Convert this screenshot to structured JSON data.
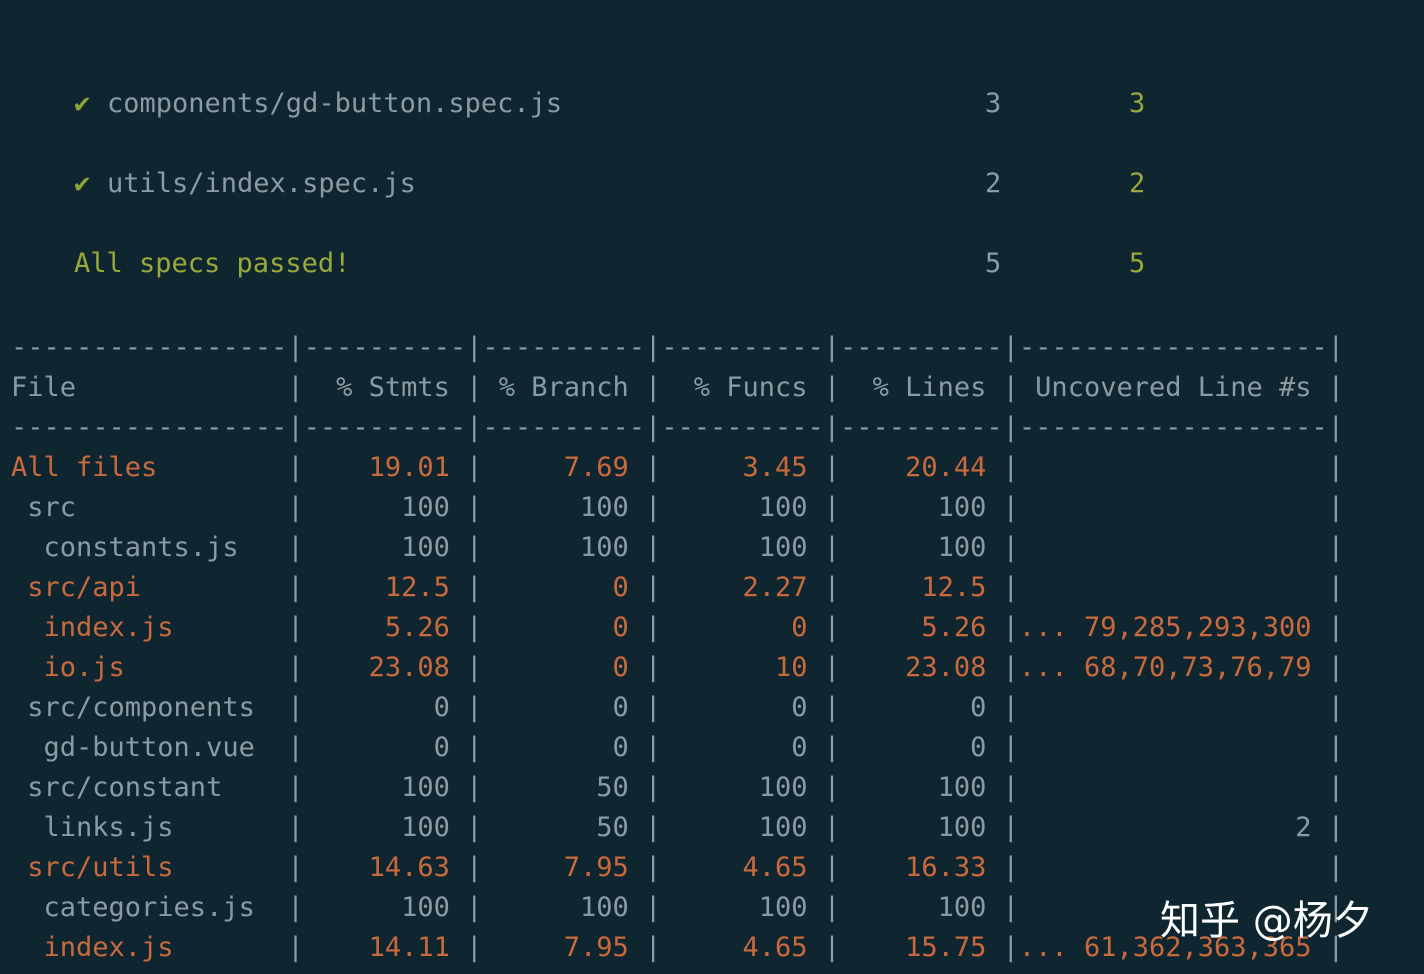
{
  "specs": [
    {
      "mark": "✔",
      "name": "components/gd-button.spec.js",
      "total": "3",
      "passed": "3"
    },
    {
      "mark": "✔",
      "name": "utils/index.spec.js",
      "total": "2",
      "passed": "2"
    }
  ],
  "summary": {
    "label": "All specs passed!",
    "total": "5",
    "passed": "5"
  },
  "coverage": {
    "separator": "-----------------|----------|----------|----------|----------|-------------------|",
    "headers": [
      "File",
      "% Stmts",
      "% Branch",
      "% Funcs",
      "% Lines",
      "Uncovered Line #s"
    ],
    "rows": [
      {
        "file": "All files",
        "indent": 0,
        "stmts": "19.01",
        "branch": "7.69",
        "funcs": "3.45",
        "lines": "20.44",
        "uncovered": "",
        "highlight": true
      },
      {
        "file": "src",
        "indent": 1,
        "stmts": "100",
        "branch": "100",
        "funcs": "100",
        "lines": "100",
        "uncovered": "",
        "highlight": false
      },
      {
        "file": "constants.js",
        "indent": 2,
        "stmts": "100",
        "branch": "100",
        "funcs": "100",
        "lines": "100",
        "uncovered": "",
        "highlight": false
      },
      {
        "file": "src/api",
        "indent": 1,
        "stmts": "12.5",
        "branch": "0",
        "funcs": "2.27",
        "lines": "12.5",
        "uncovered": "",
        "highlight": true
      },
      {
        "file": "index.js",
        "indent": 2,
        "stmts": "5.26",
        "branch": "0",
        "funcs": "0",
        "lines": "5.26",
        "uncovered": "... 79,285,293,300",
        "highlight": true
      },
      {
        "file": "io.js",
        "indent": 2,
        "stmts": "23.08",
        "branch": "0",
        "funcs": "10",
        "lines": "23.08",
        "uncovered": "... 68,70,73,76,79",
        "highlight": true
      },
      {
        "file": "src/components",
        "indent": 1,
        "stmts": "0",
        "branch": "0",
        "funcs": "0",
        "lines": "0",
        "uncovered": "",
        "highlight": false
      },
      {
        "file": "gd-button.vue",
        "indent": 2,
        "stmts": "0",
        "branch": "0",
        "funcs": "0",
        "lines": "0",
        "uncovered": "",
        "highlight": false
      },
      {
        "file": "src/constant",
        "indent": 1,
        "stmts": "100",
        "branch": "50",
        "funcs": "100",
        "lines": "100",
        "uncovered": "",
        "highlight": false
      },
      {
        "file": "links.js",
        "indent": 2,
        "stmts": "100",
        "branch": "50",
        "funcs": "100",
        "lines": "100",
        "uncovered": "2",
        "highlight": false
      },
      {
        "file": "src/utils",
        "indent": 1,
        "stmts": "14.63",
        "branch": "7.95",
        "funcs": "4.65",
        "lines": "16.33",
        "uncovered": "",
        "highlight": true
      },
      {
        "file": "categories.js",
        "indent": 2,
        "stmts": "100",
        "branch": "100",
        "funcs": "100",
        "lines": "100",
        "uncovered": "",
        "highlight": false
      },
      {
        "file": "index.js",
        "indent": 2,
        "stmts": "14.11",
        "branch": "7.95",
        "funcs": "4.65",
        "lines": "15.75",
        "uncovered": "... 61,362,363,365",
        "highlight": true
      }
    ]
  },
  "watermark": "知乎 @杨夕",
  "colors": {
    "background": "#0f2631",
    "green": "#9aa83a",
    "gray": "#8c9aa3",
    "orange": "#c96a3c"
  }
}
